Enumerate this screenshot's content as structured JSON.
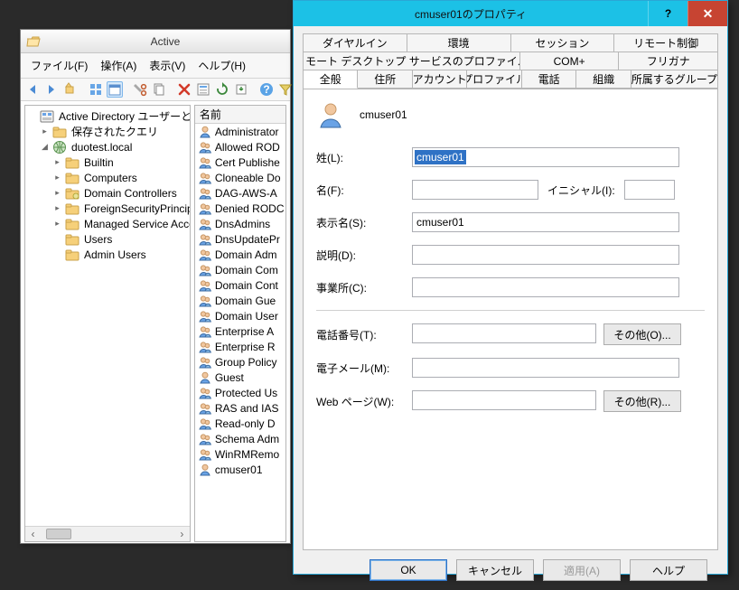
{
  "aduc": {
    "title": "Active",
    "menu": {
      "file": "ファイル(F)",
      "action": "操作(A)",
      "view": "表示(V)",
      "help": "ヘルプ(H)"
    },
    "tree": {
      "root": "Active Directory ユーザーとコン",
      "saved_queries": "保存されたクエリ",
      "domain": "duotest.local",
      "builtin": "Builtin",
      "computers": "Computers",
      "domain_controllers": "Domain Controllers",
      "fsp": "ForeignSecurityPrincip",
      "msa": "Managed Service Acco",
      "users": "Users",
      "admin_users": "Admin Users"
    },
    "list": {
      "header": "名前",
      "items": [
        {
          "n": "Administrator",
          "t": "user"
        },
        {
          "n": "Allowed ROD",
          "t": "group"
        },
        {
          "n": "Cert Publishe",
          "t": "group"
        },
        {
          "n": "Cloneable Do",
          "t": "group"
        },
        {
          "n": "DAG-AWS-A",
          "t": "group"
        },
        {
          "n": "Denied RODC",
          "t": "group"
        },
        {
          "n": "DnsAdmins",
          "t": "group"
        },
        {
          "n": "DnsUpdatePr",
          "t": "group"
        },
        {
          "n": "Domain Adm",
          "t": "group"
        },
        {
          "n": "Domain Com",
          "t": "group"
        },
        {
          "n": "Domain Cont",
          "t": "group"
        },
        {
          "n": "Domain Gue",
          "t": "group"
        },
        {
          "n": "Domain User",
          "t": "group"
        },
        {
          "n": "Enterprise A",
          "t": "group"
        },
        {
          "n": "Enterprise R",
          "t": "group"
        },
        {
          "n": "Group Policy",
          "t": "group"
        },
        {
          "n": "Guest",
          "t": "user"
        },
        {
          "n": "Protected Us",
          "t": "group"
        },
        {
          "n": "RAS and IAS",
          "t": "group"
        },
        {
          "n": "Read-only D",
          "t": "group"
        },
        {
          "n": "Schema Adm",
          "t": "group"
        },
        {
          "n": "WinRMRemo",
          "t": "group"
        },
        {
          "n": "cmuser01",
          "t": "user"
        }
      ]
    }
  },
  "dialog": {
    "title": "cmuser01のプロパティ",
    "tabs": {
      "row1": [
        "ダイヤルイン",
        "環境",
        "セッション",
        "リモート制御"
      ],
      "row2": [
        "リモート デスクトップ サービスのプロファイル",
        "COM+",
        "フリガナ"
      ],
      "row3": [
        "全般",
        "住所",
        "アカウント",
        "プロファイル",
        "電話",
        "組織",
        "所属するグループ"
      ]
    },
    "active_tab": "全般",
    "username": "cmuser01",
    "labels": {
      "last": "姓(L):",
      "first": "名(F):",
      "initial": "イニシャル(I):",
      "display": "表示名(S):",
      "desc": "説明(D):",
      "office": "事業所(C):",
      "phone": "電話番号(T):",
      "mail": "電子メール(M):",
      "web": "Web ページ(W):",
      "other_o": "その他(O)...",
      "other_r": "その他(R)..."
    },
    "values": {
      "last": "cmuser01",
      "first": "",
      "initial": "",
      "display": "cmuser01",
      "desc": "",
      "office": "",
      "phone": "",
      "mail": "",
      "web": ""
    },
    "buttons": {
      "ok": "OK",
      "cancel": "キャンセル",
      "apply": "適用(A)",
      "help": "ヘルプ"
    }
  }
}
